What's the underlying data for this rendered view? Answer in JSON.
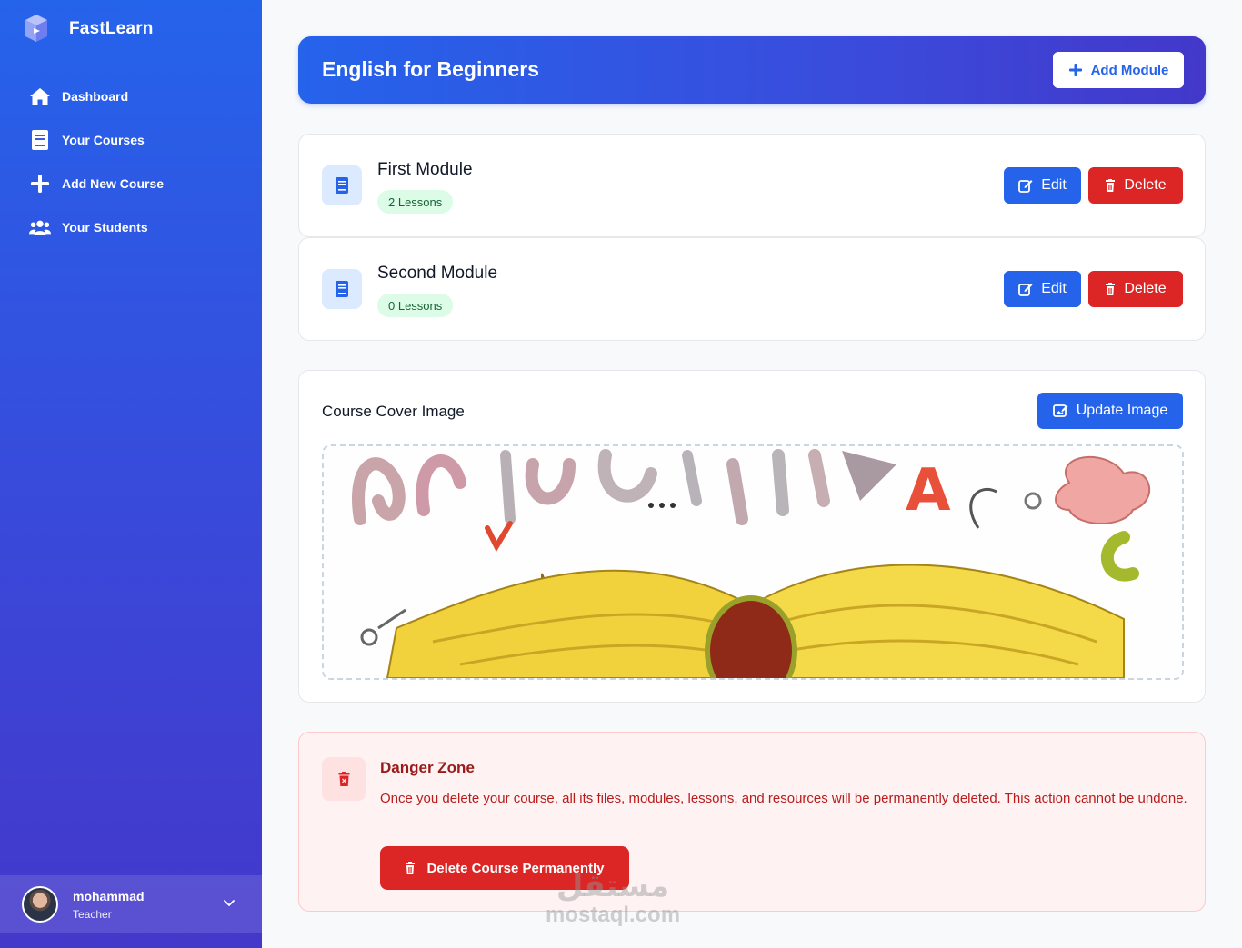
{
  "app": {
    "name": "FastLearn"
  },
  "sidebar": {
    "items": [
      {
        "label": "Dashboard",
        "icon": "home-icon"
      },
      {
        "label": "Your Courses",
        "icon": "book-icon"
      },
      {
        "label": "Add New Course",
        "icon": "plus-icon"
      },
      {
        "label": "Your Students",
        "icon": "users-icon"
      }
    ]
  },
  "user": {
    "name": "mohammad",
    "role": "Teacher"
  },
  "course": {
    "title": "English for Beginners",
    "add_module_label": "Add Module"
  },
  "modules": [
    {
      "title": "First Module",
      "lessons": "2 Lessons",
      "edit_label": "Edit",
      "delete_label": "Delete"
    },
    {
      "title": "Second Module",
      "lessons": "0 Lessons",
      "edit_label": "Edit",
      "delete_label": "Delete"
    }
  ],
  "cover": {
    "title": "Course Cover Image",
    "update_label": "Update Image"
  },
  "danger": {
    "title": "Danger Zone",
    "message": "Once you delete your course, all its files, modules, lessons, and resources will be permanently deleted. This action cannot be undone.",
    "button_label": "Delete Course Permanently"
  },
  "watermark": {
    "arabic": "مستقل",
    "latin": "mostaql.com"
  },
  "colors": {
    "primary": "#2563eb",
    "danger": "#dc2626",
    "badge_bg": "#dcfce7",
    "badge_text": "#166534"
  }
}
